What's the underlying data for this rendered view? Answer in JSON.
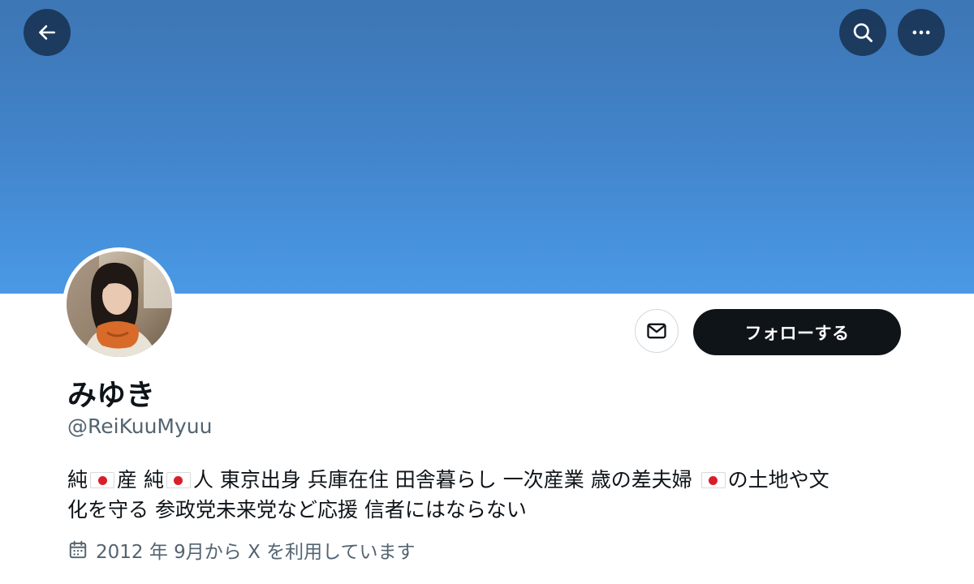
{
  "profile": {
    "display_name": "みゆき",
    "handle": "@ReiKuuMyuu",
    "bio": {
      "line1": [
        {
          "type": "text",
          "value": "純"
        },
        {
          "type": "flag",
          "icon": "japan-flag-icon"
        },
        {
          "type": "text",
          "value": "産 純"
        },
        {
          "type": "flag",
          "icon": "japan-flag-icon"
        },
        {
          "type": "text",
          "value": "人 東京出身 兵庫在住 田舎暮らし 一次産業 歳の差夫婦 "
        },
        {
          "type": "flag",
          "icon": "japan-flag-icon"
        },
        {
          "type": "text",
          "value": "の土地や文"
        }
      ],
      "line2": "化を守る 参政党未来党など応援 信者にはならない"
    },
    "joined": "2012 年 9月から X を利用しています"
  },
  "header": {
    "back_icon": "arrow-left-icon",
    "search_icon": "search-icon",
    "more_icon": "more-horizontal-icon",
    "banner_colors": [
      "#3d76b4",
      "#4a99e6"
    ]
  },
  "actions": {
    "message_icon": "mail-icon",
    "follow_label": "フォローする"
  }
}
